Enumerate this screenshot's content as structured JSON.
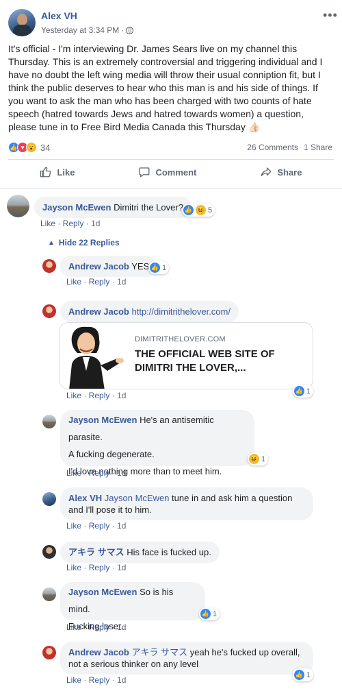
{
  "post": {
    "author": "Alex VH",
    "time": "Yesterday at 3:34 PM",
    "separator": "·",
    "more_icon": "more-horizontal-icon",
    "text": "It's official - I'm interviewing Dr. James Sears live on my channel this Thursday. This is an extremely controversial and triggering individual and I have no doubt the left wing media will throw their usual conniption fit, but I think the public deserves to hear who this man is and his side of things. If you want to ask the man who has been charged with two counts of hate speech (hatred towards Jews and hatred towards women) a question, please tune in to Free Bird Media Canada this Thursday 👍🏻",
    "reaction_count": "34",
    "comments_count": "26 Comments",
    "shares_count": "1 Share"
  },
  "actions": {
    "like": "Like",
    "comment": "Comment",
    "share": "Share"
  },
  "comment_actions": {
    "like": "Like",
    "reply": "Reply",
    "sep": "·",
    "age": "1d"
  },
  "comments": [
    {
      "name": "Jayson McEwen",
      "text": "Dimitri the Lover?",
      "react_count": "5"
    }
  ],
  "replies_toggle": "Hide 22 Replies",
  "replies": [
    {
      "name": "Andrew Jacob",
      "text": "YES",
      "react_count": "1"
    },
    {
      "name": "Andrew Jacob",
      "text": "http://dimitrithelover.com/",
      "react_count": "1",
      "preview": {
        "domain": "DIMITRITHELOVER.COM",
        "title": "THE OFFICIAL WEB SITE OF DIMITRI THE LOVER,..."
      }
    },
    {
      "name": "Jayson McEwen",
      "line1": "He's an antisemitic parasite.",
      "line2": "A fucking degenerate.",
      "line3": "I'd love nothing more than to meet him.",
      "react_count": "1"
    },
    {
      "name": "Alex VH",
      "mention": "Jayson McEwen",
      "text": "tune in and ask him a question and I'll pose it to him."
    },
    {
      "name": "アキラ サマス",
      "text": "His face is fucked up."
    },
    {
      "name": "Jayson McEwen",
      "line1": "So is his mind.",
      "line2": "Fucking loser.",
      "react_count": "1"
    },
    {
      "name": "Andrew Jacob",
      "mention": "アキラ サマス",
      "text": "yeah he's fucked up overall, not a serious thinker on any level",
      "react_count": "1"
    }
  ],
  "colors": {
    "link": "#385898",
    "like_blue": "#2d88ff",
    "love_red": "#f33e58",
    "wow_yellow": "#f7b928"
  }
}
